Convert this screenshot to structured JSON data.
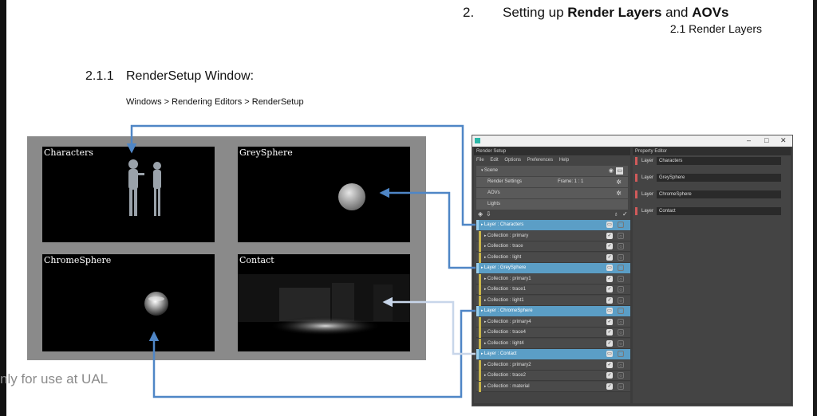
{
  "header": {
    "number": "2.",
    "title_prefix": "Setting up ",
    "title_bold1": "Render Layers",
    "title_mid": " and ",
    "title_bold2": "AOVs",
    "subtitle": "2.1 Render Layers"
  },
  "section": {
    "number": "2.1.1",
    "title": "RenderSetup Window:",
    "path": "Windows > Rendering Editors > RenderSetup"
  },
  "watermark": "nly for use at UAL",
  "preview": {
    "tiles": [
      "Characters",
      "GreySphere",
      "ChromeSphere",
      "Contact"
    ]
  },
  "maya": {
    "window_controls": [
      "–",
      "□",
      "✕"
    ],
    "render_setup": {
      "title": "Render Setup",
      "menu": [
        "File",
        "Edit",
        "Options",
        "Preferences",
        "Help"
      ],
      "scene": "Scene",
      "render_settings": "Render Settings",
      "frame": "Frame: 1 : 1",
      "aovs": "AOVs",
      "lights": "Lights"
    },
    "rows": [
      {
        "type": "layer",
        "label": "Layer : Characters"
      },
      {
        "type": "coll",
        "label": "Collection : primary"
      },
      {
        "type": "coll",
        "label": "Collection : trace"
      },
      {
        "type": "coll",
        "label": "Collection : light"
      },
      {
        "type": "layer",
        "label": "Layer : GreySphere"
      },
      {
        "type": "coll",
        "label": "Collection : primary1"
      },
      {
        "type": "coll",
        "label": "Collection : trace1"
      },
      {
        "type": "coll",
        "label": "Collection : light1"
      },
      {
        "type": "layer",
        "label": "Layer : ChromeSphere"
      },
      {
        "type": "coll",
        "label": "Collection : primary4"
      },
      {
        "type": "coll",
        "label": "Collection : trace4"
      },
      {
        "type": "coll",
        "label": "Collection : light4"
      },
      {
        "type": "layer",
        "label": "Layer : Contact"
      },
      {
        "type": "coll",
        "label": "Collection : primary2"
      },
      {
        "type": "coll",
        "label": "Collection : trace2"
      },
      {
        "type": "coll",
        "label": "Collection : material"
      }
    ],
    "property_editor": {
      "title": "Property Editor",
      "key": "Layer",
      "layers": [
        "Characters",
        "GreySphere",
        "ChromeSphere",
        "Contact"
      ]
    }
  },
  "colors": {
    "layer_row": "#5b9ec6",
    "arrow_blue": "#4f86c6",
    "arrow_light": "#b8cde8"
  }
}
